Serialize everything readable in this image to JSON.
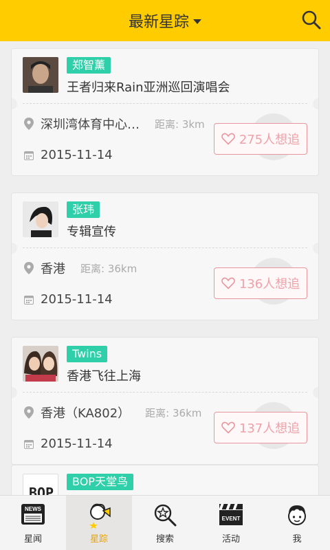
{
  "header": {
    "title": "最新星踪"
  },
  "cards": [
    {
      "tag": "郑智薰",
      "title": "王者归来Rain亚洲巡回演唱会",
      "location": "深圳湾体育中心…",
      "distance": "距离: 3km",
      "date": "2015-11-14",
      "follow": "275人想追"
    },
    {
      "tag": "张玮",
      "title": "专辑宣传",
      "location": "香港",
      "distance": "距离: 36km",
      "date": "2015-11-14",
      "follow": "136人想追"
    },
    {
      "tag": "Twins",
      "title": "香港飞往上海",
      "location": "香港（KA802）",
      "distance": "距离: 36km",
      "date": "2015-11-14",
      "follow": "137人想追"
    },
    {
      "tag": "BOP天堂鸟",
      "avatar_text": "BOP"
    }
  ],
  "tabs": [
    {
      "label": "星闻",
      "icon_text": "NEWS"
    },
    {
      "label": "星踪"
    },
    {
      "label": "搜索"
    },
    {
      "label": "活动",
      "icon_text": "EVENT"
    },
    {
      "label": "我"
    }
  ],
  "colors": {
    "header_bg": "#ffcc00",
    "tag_bg": "#2ecfa9",
    "follow_border": "#e9959d",
    "active_tab_label": "#e8a400"
  }
}
